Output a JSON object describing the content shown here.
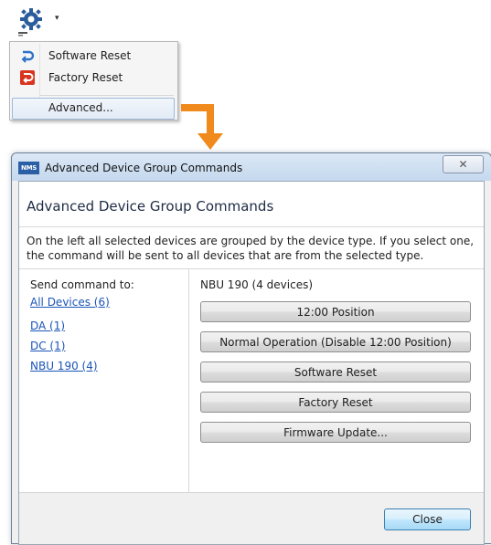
{
  "toolbar": {
    "gear_icon": "gear-icon",
    "caret": "▾"
  },
  "menu": {
    "items": [
      {
        "label": "Software Reset",
        "icon": "software-reset-icon"
      },
      {
        "label": "Factory Reset",
        "icon": "factory-reset-icon"
      },
      {
        "label": "Advanced..."
      }
    ]
  },
  "colors": {
    "arrow": "#f08a1c",
    "link": "#1a55b8",
    "factory_icon": "#d9341f",
    "software_icon": "#2e73c9"
  },
  "dialog": {
    "window_title": "Advanced Device Group Commands",
    "app_icon_text": "NMS",
    "close_glyph": "✕",
    "header": "Advanced Device Group Commands",
    "description": "On the left all selected devices are grouped by the device type. If you select one, the command will be sent to all devices that are from the selected type.",
    "send_label": "Send command to:",
    "devices": [
      "All Devices (6)",
      "DA (1)",
      "DC (1)",
      "NBU 190 (4)"
    ],
    "group_label": "NBU 190 (4 devices)",
    "commands": [
      "12:00 Position",
      "Normal Operation (Disable 12:00 Position)",
      "Software Reset",
      "Factory Reset",
      "Firmware Update..."
    ],
    "close_button": "Close"
  }
}
